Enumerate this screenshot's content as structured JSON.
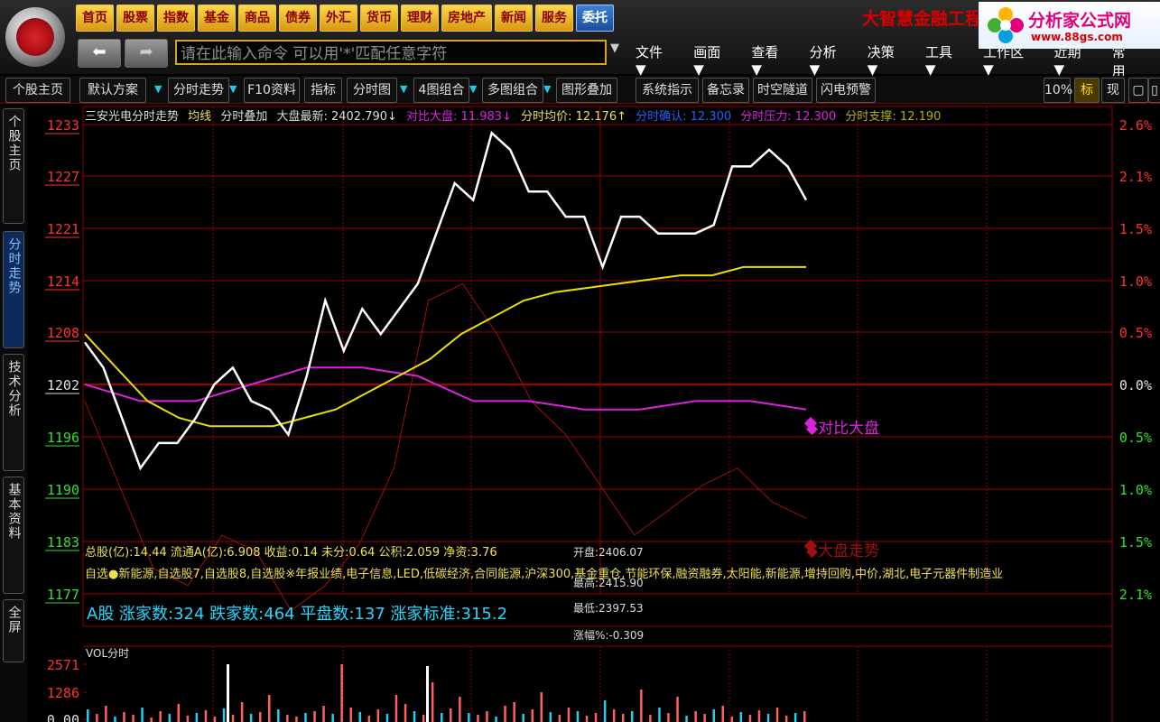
{
  "nav": [
    "首页",
    "股票",
    "指数",
    "基金",
    "商品",
    "债券",
    "外汇",
    "货币",
    "理财",
    "房地产",
    "新闻",
    "服务",
    "委托"
  ],
  "brand": {
    "left": "大智慧金融工程",
    "site": "分析家公式网",
    "url": "www.88gs.com"
  },
  "command": {
    "placeholder": "请在此输入命令    可以用'*'匹配任意字符"
  },
  "menu": [
    "文件▼",
    "画面▼",
    "查看▼",
    "分析▼",
    "决策▼",
    "工具▼",
    "工作区▼",
    "近期▼",
    "常用"
  ],
  "toolbar_tabs": [
    "个股主页",
    "默认方案",
    "分时走势",
    "F10资料",
    "指标",
    "分时图",
    "4图组合",
    "多图组合",
    "图形叠加",
    "系统指示",
    "备忘录",
    "时空隧道",
    "闪电预警"
  ],
  "toolbar_right": [
    "10%",
    "标",
    "现"
  ],
  "sidebar": [
    "个股主页",
    "分时走势",
    "技术分析",
    "基本资料",
    "全屏"
  ],
  "header": {
    "stock": "三安光电分时走势",
    "avg": "均线",
    "overlay": "分时叠加",
    "index_latest": "大盘最新: 2402.790↓",
    "compare": "对比大盘: 11.983↓",
    "avg_price": "分时均价: 12.176↑",
    "confirm": "分时确认: 12.300",
    "pressure": "分时压力: 12.300",
    "support": "分时支撑: 12.190"
  },
  "chart_data": {
    "type": "line",
    "y_left_ticks": [
      "1233",
      "1227",
      "1221",
      "1214",
      "1208",
      "1202",
      "1196",
      "1190",
      "1183",
      "1177"
    ],
    "y_right_ticks": [
      "2.6%",
      "2.1%",
      "1.5%",
      "1.0%",
      "0.5%",
      "0.0%",
      "0.5%",
      "1.0%",
      "1.5%",
      "2.1%"
    ],
    "series": [
      {
        "name": "价格",
        "color": "#ffffff",
        "values": [
          1207,
          1204,
          1198,
          1192,
          1195,
          1195,
          1198,
          1202,
          1204,
          1200,
          1199,
          1196,
          1203,
          1212,
          1206,
          1211,
          1208,
          1211,
          1214,
          1220,
          1226,
          1224,
          1232,
          1230,
          1225,
          1225,
          1222,
          1222,
          1216,
          1222,
          1222,
          1220,
          1220,
          1220,
          1221,
          1228,
          1228,
          1230,
          1228,
          1224
        ]
      },
      {
        "name": "均线",
        "color": "#e8e000",
        "values": [
          1208,
          1204,
          1200,
          1198,
          1197,
          1197,
          1197,
          1198,
          1199,
          1201,
          1203,
          1205,
          1208,
          1210,
          1212,
          1213,
          1213.5,
          1214,
          1214.5,
          1215,
          1215,
          1216,
          1216,
          1216
        ]
      },
      {
        "name": "对比大盘",
        "color": "#e020e0",
        "values": [
          1202,
          1200,
          1200,
          1202,
          1204,
          1204,
          1203,
          1200,
          1200,
          1199,
          1199,
          1200,
          1200,
          1199
        ]
      },
      {
        "name": "大盘走势",
        "color": "#a01010",
        "values": [
          1200,
          1190,
          1180,
          1178,
          1184,
          1182,
          1175,
          1178,
          1183,
          1192,
          1212,
          1214,
          1208,
          1200,
          1196,
          1190,
          1184,
          1187,
          1190,
          1192,
          1188,
          1186
        ]
      }
    ],
    "vol_label": "VOL分时",
    "vol_ticks": [
      "2571",
      "1286",
      "0.00"
    ]
  },
  "info": {
    "line1": "总股(亿):14.44 流通A(亿):6.908 收益:0.14 未分:0.64 公积:2.059 净资:3.76",
    "line2": "自选●新能源,自选股7,自选股8,自选股※年报业绩,电子信息,LED,低碳经济,合同能源,沪深300,基金重仓,节能环保,融资融券,太阳能,新能源,增持回购,中价,湖北,电子元器件制造业",
    "stats": "A股  涨家数:324  跌家数:464  平盘数:137  涨家标准:315.2",
    "open": "开盘:2406.07",
    "high": "最高:2415.90",
    "low": "最低:2397.53",
    "change": "涨幅%:-0.309"
  },
  "legend": {
    "compare": "◆对比大盘",
    "index": "◆大盘走势"
  }
}
